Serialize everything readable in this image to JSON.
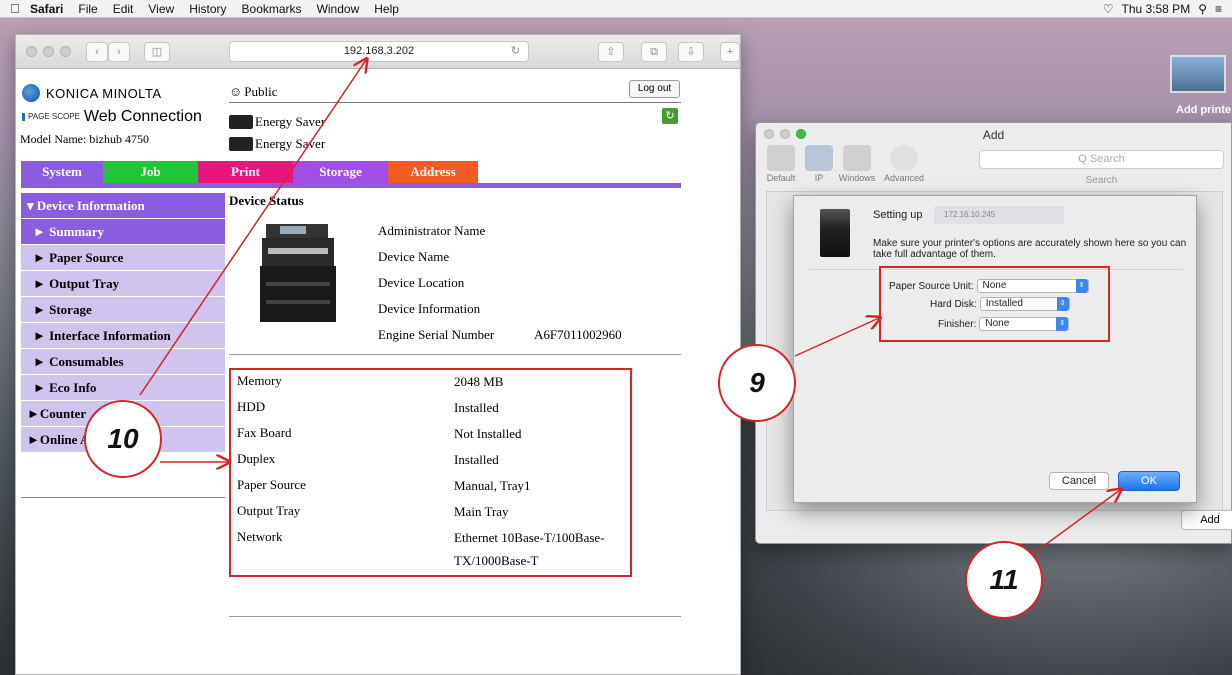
{
  "menubar": {
    "apple": "",
    "items": [
      "Safari",
      "File",
      "Edit",
      "View",
      "History",
      "Bookmarks",
      "Window",
      "Help"
    ],
    "clock": "Thu 3:58 PM"
  },
  "safari": {
    "url": "192.168.3.202"
  },
  "webpage": {
    "brand": "KONICA MINOLTA",
    "pagescope_small": "PAGE SCOPE",
    "pagescope_title": "Web Connection",
    "model_name": "Model Name: bizhub 4750",
    "user": "Public",
    "logout": "Log out",
    "energy_saver_1": "Energy Saver",
    "energy_saver_2": "Energy Saver",
    "tabs": [
      {
        "label": "System",
        "color": "#8a5de0"
      },
      {
        "label": "Job",
        "color": "#22c43a"
      },
      {
        "label": "Print",
        "color": "#e8157c"
      },
      {
        "label": "Storage",
        "color": "#a24ee6"
      },
      {
        "label": "Address",
        "color": "#f25b22"
      }
    ],
    "sidebar": {
      "device_information": "▾ Device Information",
      "items": [
        "► Summary",
        "► Paper Source",
        "► Output Tray",
        "► Storage",
        "► Interface Information",
        "► Consumables",
        "► Eco Info"
      ],
      "counter": "►Counter",
      "online": "►Online A"
    },
    "device_status_title": "Device Status",
    "device_info": [
      {
        "label": "Administrator Name",
        "value": ""
      },
      {
        "label": "Device Name",
        "value": ""
      },
      {
        "label": "Device Location",
        "value": ""
      },
      {
        "label": "Device Information",
        "value": ""
      },
      {
        "label": "Engine Serial Number",
        "value": "A6F7011002960"
      }
    ],
    "specs": [
      {
        "label": "Memory",
        "value": "2048 MB"
      },
      {
        "label": "HDD",
        "value": "Installed"
      },
      {
        "label": "Fax Board",
        "value": "Not Installed"
      },
      {
        "label": "Duplex",
        "value": "Installed"
      },
      {
        "label": "Paper Source",
        "value": "Manual, Tray1"
      },
      {
        "label": "Output Tray",
        "value": "Main Tray"
      },
      {
        "label": "Network",
        "value": "Ethernet 10Base-T/100Base-TX/1000Base-T"
      }
    ]
  },
  "printer_window": {
    "title": "Add",
    "tools": [
      "Default",
      "IP",
      "Windows",
      "Advanced"
    ],
    "search_placeholder": "Q Search",
    "search_label": "Search",
    "add_button": "Add",
    "desktop_label": "Add printe"
  },
  "sheet": {
    "setting_up": "Setting up",
    "ip": "172.16.10.245",
    "description": "Make sure your printer's options are accurately shown here so you can take full advantage of them.",
    "options": [
      {
        "label": "Paper Source Unit:",
        "value": "None"
      },
      {
        "label": "Hard Disk:",
        "value": "Installed"
      },
      {
        "label": "Finisher:",
        "value": "None"
      }
    ],
    "cancel": "Cancel",
    "ok": "OK"
  },
  "annotations": {
    "step9": "9",
    "step10": "10",
    "step11": "11",
    "color": "#d8232a"
  }
}
